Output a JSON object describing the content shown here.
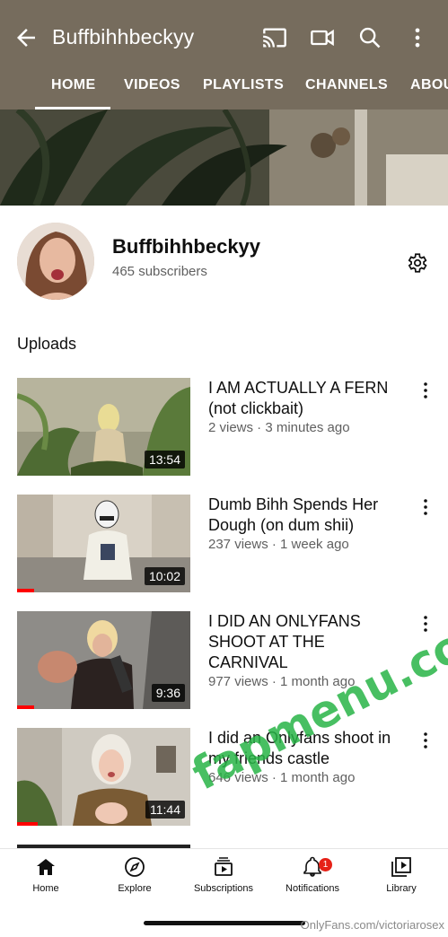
{
  "header": {
    "title": "Buffbihhbeckyy",
    "icons": [
      "back-arrow-icon",
      "cast-icon",
      "video-camera-icon",
      "search-icon",
      "more-vert-icon"
    ],
    "tabs": [
      {
        "label": "HOME",
        "active": true
      },
      {
        "label": "VIDEOS"
      },
      {
        "label": "PLAYLISTS"
      },
      {
        "label": "CHANNELS"
      },
      {
        "label": "ABOUT"
      }
    ]
  },
  "channel": {
    "name": "Buffbihhbeckyy",
    "subscribers": "465 subscribers",
    "settings_icon": "gear-icon"
  },
  "section": {
    "title": "Uploads"
  },
  "videos": [
    {
      "title": "I AM ACTUALLY A FERN (not clickbait)",
      "meta": "2 views · 3 minutes ago",
      "duration": "13:54",
      "watched": 0
    },
    {
      "title": "Dumb Bihh Spends Her Dough (on dum shii)",
      "meta": "237 views · 1 week ago",
      "duration": "10:02",
      "watched": 0.1
    },
    {
      "title": "I DID AN ONLYFANS SHOOT AT THE CARNIVAL",
      "meta": "977 views · 1 month ago",
      "duration": "9:36",
      "watched": 0.1
    },
    {
      "title": "I did an Onlyfans shoot in my friends castle",
      "meta": "646 views · 1 month ago",
      "duration": "11:44",
      "watched": 0.12
    }
  ],
  "bottom_nav": [
    {
      "label": "Home",
      "icon": "home-icon",
      "active": true
    },
    {
      "label": "Explore",
      "icon": "compass-icon"
    },
    {
      "label": "Subscriptions",
      "icon": "subscriptions-icon"
    },
    {
      "label": "Notifications",
      "icon": "bell-icon",
      "badge": "1"
    },
    {
      "label": "Library",
      "icon": "library-icon"
    }
  ],
  "overlays": {
    "watermark": "fapmenu.com",
    "source": "OnlyFans.com/victoriarosex"
  },
  "colors": {
    "appbar": "#766c5d",
    "progress": "#ff0000",
    "watermark": "#28b446"
  }
}
